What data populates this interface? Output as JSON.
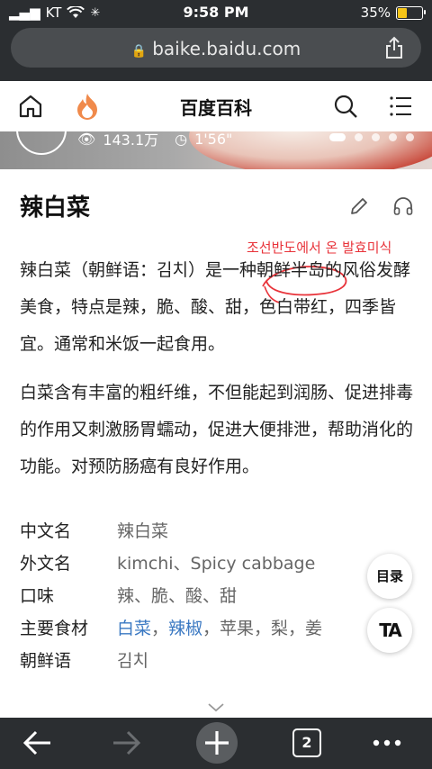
{
  "status": {
    "carrier": "KT",
    "time": "9:58 PM",
    "battery": "35%"
  },
  "browser": {
    "url": "baike.baidu.com",
    "tab_count": "2"
  },
  "header": {
    "title": "百度百科"
  },
  "banner": {
    "views": "143.1万",
    "duration": "1'56\""
  },
  "entry": {
    "title": "辣白菜",
    "annotation": "조선반도에서 온 발효미식",
    "paragraph1": "辣白菜（朝鲜语：김치）是一种朝鲜半岛的风俗发酵美食，特点是辣，脆、酸、甜，色白带红，四季皆宜。通常和米饭一起食用。",
    "paragraph2": "白菜含有丰富的粗纤维，不但能起到润肠、促进排毒的作用又刺激肠胃蠕动，促进大便排泄，帮助消化的功能。对预防肠癌有良好作用。"
  },
  "info": {
    "chinese_name": {
      "label": "中文名",
      "value": "辣白菜"
    },
    "foreign_name": {
      "label": "外文名",
      "value": "kimchi、Spicy cabbage"
    },
    "taste": {
      "label": "口味",
      "value": "辣、脆、酸、甜"
    },
    "ingredients": {
      "label": "主要食材",
      "link1": "白菜",
      "sep1": "，",
      "link2": "辣椒",
      "rest": "，苹果，梨，姜"
    },
    "korean": {
      "label": "朝鲜语",
      "value": "김치"
    }
  },
  "floating": {
    "toc": "目录",
    "ta": "TA"
  },
  "colors": {
    "link": "#3a78c2",
    "annotation": "#e8333a",
    "toolbar": "#2b2e31"
  }
}
